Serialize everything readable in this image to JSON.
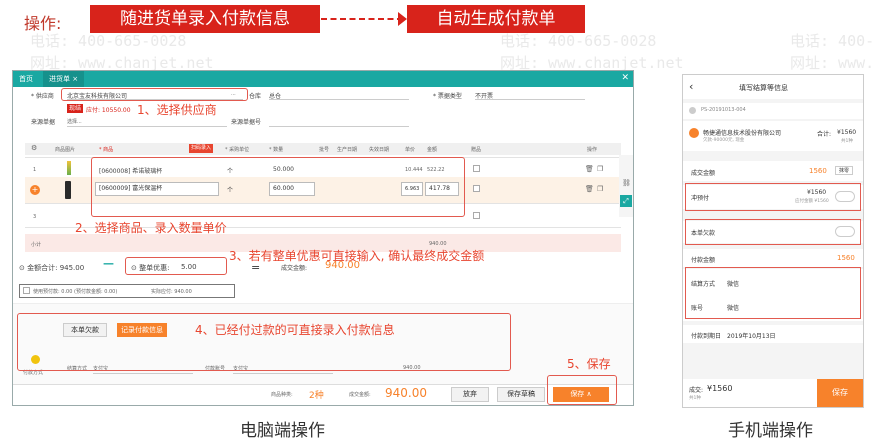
{
  "header": {
    "label": "操作:",
    "step_a": "随进货单录入付款信息",
    "step_b": "自动生成付款单"
  },
  "watermark": {
    "phone": "电话: 400-665-0028",
    "site": "网址: www.chanjet.net"
  },
  "desktop": {
    "tabs": [
      "首页",
      "进货单 ×"
    ],
    "supplier_label": "* 供应商",
    "supplier_value": "北京宝友科技有限公司",
    "supplier_more": "...",
    "warehouse_label": "仓库",
    "warehouse_value": "总仓",
    "invoice_label": "* 票据类型",
    "invoice_value": "不开票",
    "payable_tag": "现结",
    "payable_text": "应付: 10550.00",
    "source_label": "来源单据",
    "source_placeholder": "选择...",
    "source_no_label": "来源单据号",
    "table": {
      "headers": [
        "商品图片",
        "* 商品",
        "扫码录入",
        "* 采购单位",
        "* 数量",
        "批号",
        "生产日期",
        "失效日期",
        "单价",
        "金额",
        "赠品",
        "操作"
      ],
      "rows": [
        {
          "no": "1",
          "item": "[0600008] 希诺玻璃杯",
          "unit": "个",
          "qty": "50.000",
          "price": "10.444",
          "amount": "522.22"
        },
        {
          "no": "2",
          "item": "[0600009] 富光保温杯",
          "unit": "个",
          "qty": "60.000",
          "price": "6.963",
          "amount": "417.78"
        },
        {
          "no": "3",
          "item": "",
          "unit": "",
          "qty": "",
          "price": "",
          "amount": ""
        }
      ],
      "subtotal_label": "小计",
      "subtotal_amount": "940.00"
    },
    "total_label": "金额合计:",
    "total_value": "945.00",
    "minus": "—",
    "discount_label": "整单优惠:",
    "discount_value": "5.00",
    "equals": "=",
    "deal_label": "成交金额:",
    "deal_value": "940.00",
    "prepay_text": "使用预付款: 0.00 (预付款金额: 0.00)",
    "actual_pay": "实际应付: 940.00",
    "btn_owe": "本单欠款",
    "btn_record": "记录付款信息",
    "pay_method_label": "付款方式",
    "settle_label": "结算方式",
    "settle_value": "支付宝",
    "account_label": "付款账号",
    "account_value": "支付宝",
    "pay_amount": "940.00",
    "goods_kinds_label": "商品种类:",
    "goods_kinds_value": "2种",
    "footer_deal_label": "成交金额:",
    "footer_deal_value": "940.00",
    "btn_discard": "放弃",
    "btn_draft": "保存草稿",
    "btn_save": "保存 ∧"
  },
  "annotations": {
    "a1": "1、选择供应商",
    "a2": "2、选择商品、录入数量单价",
    "a3": "3、若有整单优惠可直接输入, 确认最终成交金额",
    "a4": "4、已经付过款的可直接录入付款信息",
    "a5": "5、保存"
  },
  "phone": {
    "title": "填写结算等信息",
    "order_no": "PS-20191013-004",
    "company": "畅捷通信息技术股份有限公司",
    "company_sub": "欠款-90000元, 现金",
    "total_label": "合计:",
    "total_value": "¥1560",
    "total_sub": "共1种",
    "deal_label": "成交金额",
    "deal_value": "1560",
    "deal_btn": "抹零",
    "prepay_label": "冲预付",
    "prepay_value": "¥1560",
    "prepay_sub": "应付金额 ¥1560",
    "owe_label": "本单欠款",
    "paid_label": "付款金额",
    "paid_value": "1560",
    "settle_label": "结算方式",
    "settle_value": "微信",
    "account_label": "账号",
    "account_value": "微信",
    "pay_date_label": "付款到期日",
    "pay_date_value": "2019年10月13日",
    "bottom_label": "成交:",
    "bottom_value": "¥1560",
    "bottom_sub": "共1种",
    "save": "保存"
  },
  "captions": {
    "desktop": "电脑端操作",
    "mobile": "手机端操作"
  }
}
